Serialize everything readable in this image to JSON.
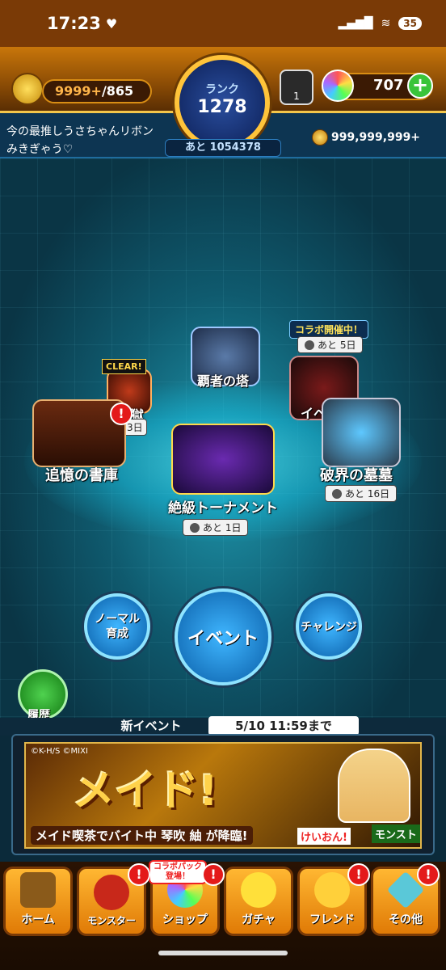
{
  "status": {
    "time": "17:23",
    "battery": "35"
  },
  "header": {
    "stamina": "9999+",
    "stamina_max": "/865",
    "rank_label": "ランク",
    "rank": "1278",
    "rank_next": "あと 1054378",
    "potion_count": "1",
    "orbs": "707",
    "plus": "+",
    "title": "今の最推しうさちゃんリボン",
    "user_name": "みきぎゃう♡",
    "gold": "999,999,999+"
  },
  "quests": {
    "tower": "覇者の塔",
    "collab_tag": "コラボ開催中！",
    "collab_timer": "あと 5日",
    "event": "イベン",
    "clear_tag": "CLEAR!",
    "hell": "獄",
    "hell_timer": "3日",
    "memory": "追憶の書庫",
    "tournament": "絶級トーナメント",
    "tournament_timer": "あと 1日",
    "tomb": "破界の墓墓",
    "tomb_timer": "あと 16日"
  },
  "modes": {
    "normal": "ノーマル\n育成",
    "event": "イベント",
    "challenge": "チャレンジ",
    "history": "履歴"
  },
  "news": {
    "label": "新イベント",
    "deadline": "5/10 11:59まで"
  },
  "banner": {
    "copyright": "©K-H/S  ©MIXI",
    "headline": "メイド!",
    "subtitle": "メイド喫茶でバイト中 琴吹 紬 が降臨!",
    "logo1": "けいおん!",
    "logo2": "モンスト"
  },
  "tabs": [
    "ホーム",
    "モンスター",
    "ショップ",
    "ガチャ",
    "フレンド",
    "その他"
  ],
  "collab_pack": "コラボパック\n登場！",
  "alert": "!"
}
